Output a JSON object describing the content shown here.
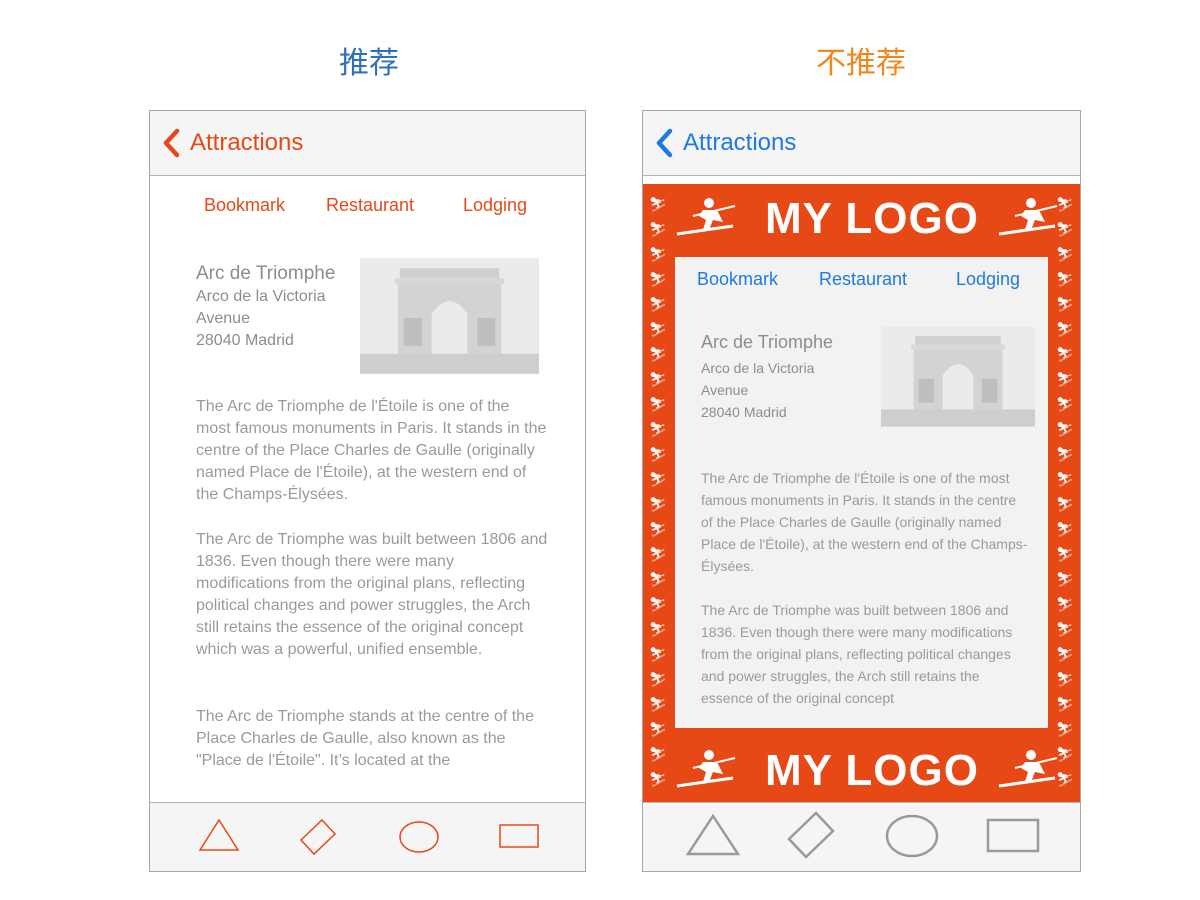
{
  "headings": {
    "left": "推荐",
    "right": "不推荐"
  },
  "colors": {
    "accent_left": "#e64916",
    "accent_right": "#1f7ae0",
    "brand_bg": "#e64916"
  },
  "phone_left": {
    "nav": {
      "back_label": "Attractions"
    },
    "links": [
      "Bookmark",
      "Restaurant",
      "Lodging"
    ],
    "place": {
      "name": "Arc de Triomphe",
      "address": [
        "Arco de la Victoria",
        "Avenue",
        "28040 Madrid"
      ]
    },
    "paragraphs": [
      "The Arc de Triomphe de l'Étoile is one of the most famous monuments in Paris. It stands in the centre of the Place Charles de Gaulle (originally named Place de l'Étoile), at the western end of the Champs-Élysées.",
      "The Arc de Triomphe was built between 1806 and 1836. Even though there were many modifications from the original plans, reflecting political changes and power struggles, the Arch still retains the essence of the original concept which was a powerful, unified ensemble.",
      "The Arc de Triomphe stands at the centre of the Place Charles de Gaulle, also known as the \"Place de l'Étoile\". It’s located at the"
    ],
    "tabs": [
      "triangle-icon",
      "diamond-icon",
      "circle-icon",
      "rectangle-icon"
    ]
  },
  "phone_right": {
    "nav": {
      "back_label": "Attractions"
    },
    "logo_text": "MY LOGO",
    "links": [
      "Bookmark",
      "Restaurant",
      "Lodging"
    ],
    "place": {
      "name": "Arc de Triomphe",
      "address": [
        "Arco de la Victoria",
        "Avenue",
        "28040 Madrid"
      ]
    },
    "paragraphs": [
      "The Arc de Triomphe de l'Étoile is one of the most famous monuments in Paris. It stands in the centre of the Place Charles de Gaulle (originally named Place de l'Étoile), at the western end of the Champs-Élysées.",
      "The Arc de Triomphe was built between 1806 and 1836. Even though there were many modifications from the original plans, reflecting political changes and power struggles, the Arch still retains the essence of the original concept"
    ],
    "tabs": [
      "triangle-icon",
      "diamond-icon",
      "circle-icon",
      "rectangle-icon"
    ]
  }
}
